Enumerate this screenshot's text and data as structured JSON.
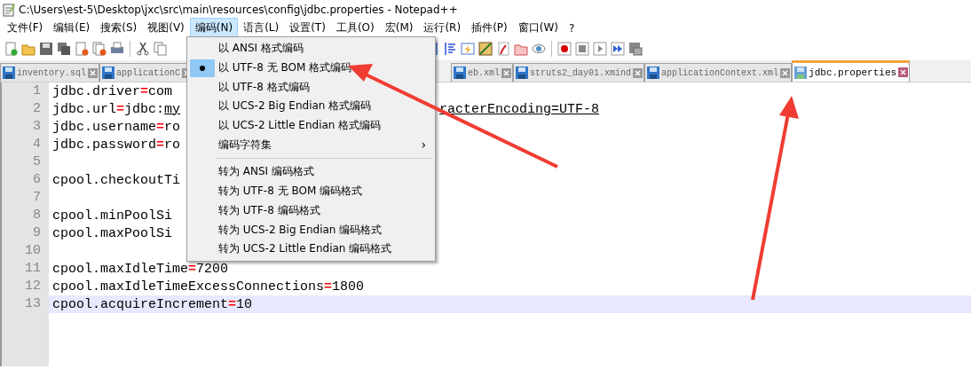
{
  "window": {
    "title": "C:\\Users\\est-5\\Desktop\\jxc\\src\\main\\resources\\config\\jdbc.properties - Notepad++"
  },
  "menu_bar": [
    {
      "label": "文件(F)",
      "selected": false
    },
    {
      "label": "编辑(E)",
      "selected": false
    },
    {
      "label": "搜索(S)",
      "selected": false
    },
    {
      "label": "视图(V)",
      "selected": false
    },
    {
      "label": "编码(N)",
      "selected": true
    },
    {
      "label": "语言(L)",
      "selected": false
    },
    {
      "label": "设置(T)",
      "selected": false
    },
    {
      "label": "工具(O)",
      "selected": false
    },
    {
      "label": "宏(M)",
      "selected": false
    },
    {
      "label": "运行(R)",
      "selected": false
    },
    {
      "label": "插件(P)",
      "selected": false
    },
    {
      "label": "窗口(W)",
      "selected": false
    },
    {
      "label": "?",
      "selected": false
    }
  ],
  "tabs_left": [
    {
      "label": "inventory.sql",
      "selected": false
    },
    {
      "label": "applicationC",
      "selected": false
    }
  ],
  "tabs_right": [
    {
      "label": "eb.xml",
      "selected": false
    },
    {
      "label": "struts2_day01.xmind",
      "selected": false
    },
    {
      "label": "applicationContext.xml",
      "selected": false
    },
    {
      "label": "jdbc.properties",
      "selected": true
    }
  ],
  "editor": {
    "lines": [
      {
        "number": "1",
        "current": false,
        "segments": [
          {
            "kind": "plain",
            "text": "jdbc.driver"
          },
          {
            "kind": "operator",
            "text": "="
          },
          {
            "kind": "plain",
            "text": "com"
          }
        ]
      },
      {
        "number": "2",
        "current": false,
        "segments": [
          {
            "kind": "plain",
            "text": "jdbc.url"
          },
          {
            "kind": "operator",
            "text": "="
          },
          {
            "kind": "plain",
            "text": "jdbc:"
          },
          {
            "kind": "link",
            "text": "my"
          }
        ],
        "tail": "racterEncoding=UTF-8"
      },
      {
        "number": "3",
        "current": false,
        "segments": [
          {
            "kind": "plain",
            "text": "jdbc.username"
          },
          {
            "kind": "operator",
            "text": "="
          },
          {
            "kind": "plain",
            "text": "ro"
          }
        ]
      },
      {
        "number": "4",
        "current": false,
        "segments": [
          {
            "kind": "plain",
            "text": "jdbc.password"
          },
          {
            "kind": "operator",
            "text": "="
          },
          {
            "kind": "plain",
            "text": "ro"
          }
        ]
      },
      {
        "number": "5",
        "current": false
      },
      {
        "number": "6",
        "current": false,
        "segments": [
          {
            "kind": "plain",
            "text": "cpool.checkoutTi"
          }
        ]
      },
      {
        "number": "7",
        "current": false
      },
      {
        "number": "8",
        "current": false,
        "segments": [
          {
            "kind": "plain",
            "text": "cpool.minPoolSi"
          }
        ]
      },
      {
        "number": "9",
        "current": false,
        "segments": [
          {
            "kind": "plain",
            "text": "cpool.maxPoolSi"
          }
        ]
      },
      {
        "number": "10",
        "current": false
      },
      {
        "number": "11",
        "current": false,
        "segments": [
          {
            "kind": "plain",
            "text": "cpool.maxIdleTime"
          },
          {
            "kind": "operator",
            "text": "="
          },
          {
            "kind": "plain",
            "text": "7200"
          }
        ]
      },
      {
        "number": "12",
        "current": false,
        "segments": [
          {
            "kind": "plain",
            "text": "cpool.maxIdleTimeExcessConnections"
          },
          {
            "kind": "operator",
            "text": "="
          },
          {
            "kind": "plain",
            "text": "1800"
          }
        ]
      },
      {
        "number": "13",
        "current": true,
        "segments": [
          {
            "kind": "plain",
            "text": "cpool.acquireIncrement"
          },
          {
            "kind": "operator",
            "text": "="
          },
          {
            "kind": "plain",
            "text": "10"
          }
        ]
      }
    ]
  },
  "encoding_menu": [
    {
      "kind": "item",
      "label": "以 ANSI 格式编码",
      "checked": false
    },
    {
      "kind": "item",
      "label": "以 UTF-8 无 BOM 格式编码",
      "checked": true
    },
    {
      "kind": "item",
      "label": "以 UTF-8 格式编码",
      "checked": false
    },
    {
      "kind": "item",
      "label": "以 UCS-2 Big Endian 格式编码",
      "checked": false
    },
    {
      "kind": "item",
      "label": "以 UCS-2 Little Endian 格式编码",
      "checked": false
    },
    {
      "kind": "submenu",
      "label": "编码字符集",
      "arrow": "›"
    },
    {
      "kind": "separator"
    },
    {
      "kind": "item",
      "label": "转为 ANSI 编码格式",
      "checked": false
    },
    {
      "kind": "item",
      "label": "转为 UTF-8 无 BOM 编码格式",
      "checked": false
    },
    {
      "kind": "item",
      "label": "转为 UTF-8 编码格式",
      "checked": false
    },
    {
      "kind": "item",
      "label": "转为 UCS-2 Big Endian 编码格式",
      "checked": false
    },
    {
      "kind": "item",
      "label": "转为 UCS-2 Little Endian 编码格式",
      "checked": false
    }
  ]
}
